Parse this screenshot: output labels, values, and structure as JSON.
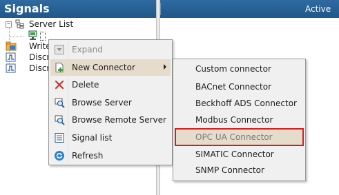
{
  "left_panel": {
    "title": "Signals",
    "tree": {
      "server_list": "Server List",
      "write": "Write",
      "disc1": "Discr",
      "disc2": "Discr"
    }
  },
  "right_panel": {
    "column_active": "Active"
  },
  "context_menu": {
    "items": [
      {
        "label": "Expand",
        "icon": "expand-icon"
      },
      {
        "label": "New Connector",
        "icon": "new-connector-icon"
      },
      {
        "label": "Delete",
        "icon": "delete-icon"
      },
      {
        "label": "Browse Server",
        "icon": "browse-server-icon"
      },
      {
        "label": "Browse Remote Server",
        "icon": "browse-remote-server-icon"
      },
      {
        "label": "Signal list",
        "icon": "signal-list-icon"
      },
      {
        "label": "Refresh",
        "icon": "refresh-icon"
      }
    ]
  },
  "submenu": {
    "items": [
      {
        "label": "Custom connector"
      },
      {
        "label": "BACnet Connector"
      },
      {
        "label": "Beckhoff ADS Connector"
      },
      {
        "label": "Modbus Connector"
      },
      {
        "label": "OPC UA Connector"
      },
      {
        "label": "SIMATIC Connector"
      },
      {
        "label": "SNMP Connector"
      }
    ]
  },
  "colors": {
    "header_blue": "#2a6296",
    "menu_bg": "#f0f0f0",
    "highlight": "#e6dccb",
    "selection_outline": "#d41f1f"
  }
}
